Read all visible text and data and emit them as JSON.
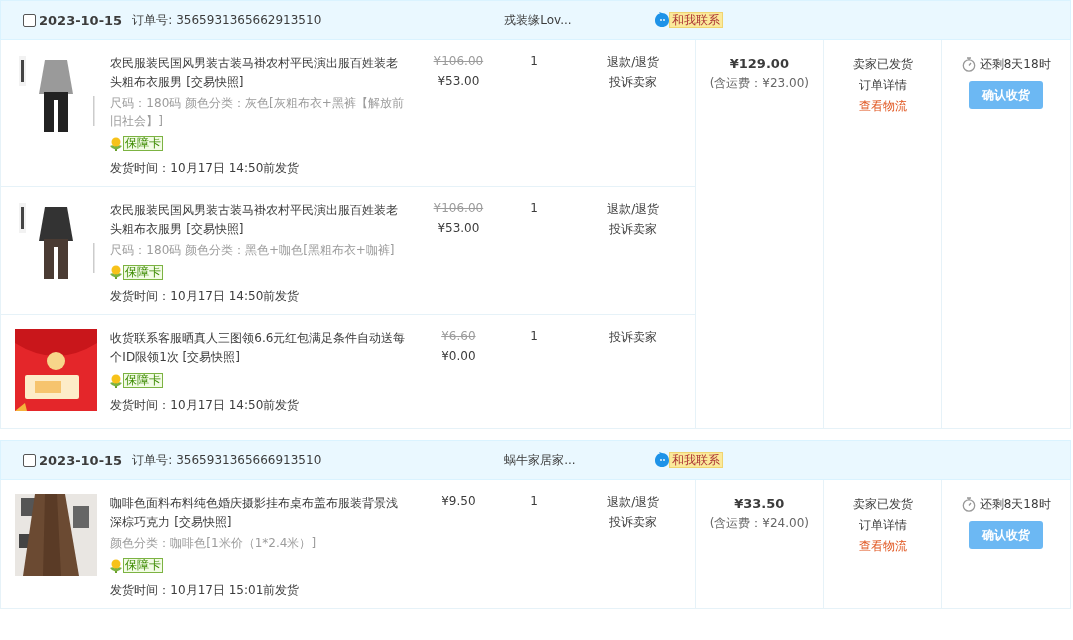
{
  "orders": [
    {
      "checked": false,
      "date": "2023-10-15",
      "order_label": "订单号:",
      "order_no": "3565931365662913510",
      "shop": "戎装缘Lov...",
      "contact": "和我联系",
      "items": [
        {
          "title": "农民服装民国风男装古装马褂农村平民演出服百姓装老头粗布衣服男",
          "snapshot": "[交易快照]",
          "specs": "尺码：180码  颜色分类：灰色[灰粗布衣+黑裤【解放前旧社会】]",
          "badge": "保障卡",
          "ship_time": "发货时间：10月17日 14:50前发货",
          "original_price": "¥106.00",
          "price": "¥53.00",
          "quantity": "1",
          "actions": [
            "退款/退货",
            "投诉卖家"
          ]
        },
        {
          "title": "农民服装民国风男装古装马褂农村平民演出服百姓装老头粗布衣服男",
          "snapshot": "[交易快照]",
          "specs": "尺码：180码  颜色分类：黑色+咖色[黑粗布衣+咖裤]",
          "badge": "保障卡",
          "ship_time": "发货时间：10月17日 14:50前发货",
          "original_price": "¥106.00",
          "price": "¥53.00",
          "quantity": "1",
          "actions": [
            "退款/退货",
            "投诉卖家"
          ]
        },
        {
          "title": "收货联系客服晒真人三图领6.6元红包满足条件自动送每个ID限领1次",
          "snapshot": "[交易快照]",
          "badge": "保障卡",
          "ship_time": "发货时间：10月17日 14:50前发货",
          "original_price": "¥6.60",
          "price": "¥0.00",
          "quantity": "1",
          "actions": [
            "投诉卖家"
          ]
        }
      ],
      "total": "¥129.00",
      "shipping": "(含运费：¥23.00)",
      "status": [
        {
          "kind": "text",
          "text": "卖家已发货"
        },
        {
          "kind": "link",
          "text": "订单详情"
        },
        {
          "kind": "logistics",
          "text": "查看物流"
        }
      ],
      "countdown": "还剩8天18时",
      "confirm": "确认收货"
    },
    {
      "checked": false,
      "date": "2023-10-15",
      "order_label": "订单号:",
      "order_no": "3565931365666913510",
      "shop": "蜗牛家居家...",
      "contact": "和我联系",
      "items": [
        {
          "title": "咖啡色面料布料纯色婚庆摄影挂布桌布盖布服装背景浅深棕巧克力",
          "snapshot": "[交易快照]",
          "specs": "颜色分类：咖啡色[1米价（1*2.4米）]",
          "badge": "保障卡",
          "ship_time": "发货时间：10月17日 15:01前发货",
          "price": "¥9.50",
          "quantity": "1",
          "actions": [
            "退款/退货",
            "投诉卖家"
          ]
        }
      ],
      "total": "¥33.50",
      "shipping": "(含运费：¥24.00)",
      "status": [
        {
          "kind": "text",
          "text": "卖家已发货"
        },
        {
          "kind": "link",
          "text": "订单详情"
        },
        {
          "kind": "logistics",
          "text": "查看物流"
        }
      ],
      "countdown": "还剩8天18时",
      "confirm": "确认收货"
    }
  ]
}
